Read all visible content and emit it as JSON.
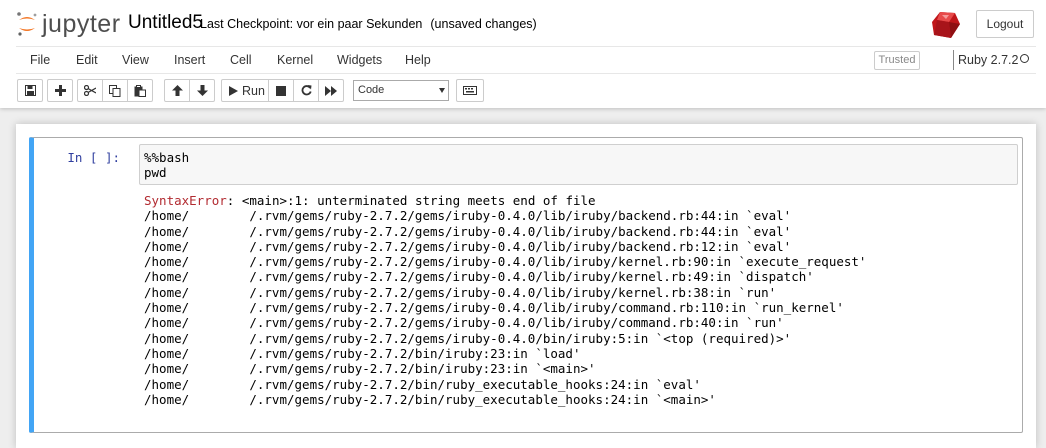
{
  "header": {
    "logo_text": "jupyter",
    "notebook_name": "Untitled5",
    "checkpoint": "Last Checkpoint: vor ein paar Sekunden",
    "unsaved": "(unsaved changes)",
    "logout_label": "Logout"
  },
  "menu": {
    "items": [
      "File",
      "Edit",
      "View",
      "Insert",
      "Cell",
      "Kernel",
      "Widgets",
      "Help"
    ],
    "trusted": "Trusted",
    "kernel_name": "Ruby 2.7.2"
  },
  "toolbar": {
    "icons": [
      "save-icon",
      "plus-icon",
      "cut-icon",
      "copy-icon",
      "paste-icon",
      "arrow-up-icon",
      "arrow-down-icon",
      "play-icon",
      "stop-icon",
      "restart-icon",
      "fast-forward-icon",
      "keyboard-icon"
    ],
    "run_label": "Run",
    "cell_type": "Code"
  },
  "cell": {
    "prompt": "In [ ]:",
    "input_lines": [
      "%%bash",
      "pwd"
    ],
    "error_name": "SyntaxError",
    "error_message": ": <main>:1: unterminated string meets end of file",
    "traceback": [
      "/home/        /.rvm/gems/ruby-2.7.2/gems/iruby-0.4.0/lib/iruby/backend.rb:44:in `eval'",
      "/home/        /.rvm/gems/ruby-2.7.2/gems/iruby-0.4.0/lib/iruby/backend.rb:44:in `eval'",
      "/home/        /.rvm/gems/ruby-2.7.2/gems/iruby-0.4.0/lib/iruby/backend.rb:12:in `eval'",
      "/home/        /.rvm/gems/ruby-2.7.2/gems/iruby-0.4.0/lib/iruby/kernel.rb:90:in `execute_request'",
      "/home/        /.rvm/gems/ruby-2.7.2/gems/iruby-0.4.0/lib/iruby/kernel.rb:49:in `dispatch'",
      "/home/        /.rvm/gems/ruby-2.7.2/gems/iruby-0.4.0/lib/iruby/kernel.rb:38:in `run'",
      "/home/        /.rvm/gems/ruby-2.7.2/gems/iruby-0.4.0/lib/iruby/command.rb:110:in `run_kernel'",
      "/home/        /.rvm/gems/ruby-2.7.2/gems/iruby-0.4.0/lib/iruby/command.rb:40:in `run'",
      "/home/        /.rvm/gems/ruby-2.7.2/gems/iruby-0.4.0/bin/iruby:5:in `<top (required)>'",
      "/home/        /.rvm/gems/ruby-2.7.2/bin/iruby:23:in `load'",
      "/home/        /.rvm/gems/ruby-2.7.2/bin/iruby:23:in `<main>'",
      "/home/        /.rvm/gems/ruby-2.7.2/bin/ruby_executable_hooks:24:in `eval'",
      "/home/        /.rvm/gems/ruby-2.7.2/bin/ruby_executable_hooks:24:in `<main>'"
    ]
  },
  "colors": {
    "accent": "#42a5f5",
    "prompt": "#303f9f",
    "error": "#b22b31",
    "jupyter_orange": "#f37726"
  }
}
